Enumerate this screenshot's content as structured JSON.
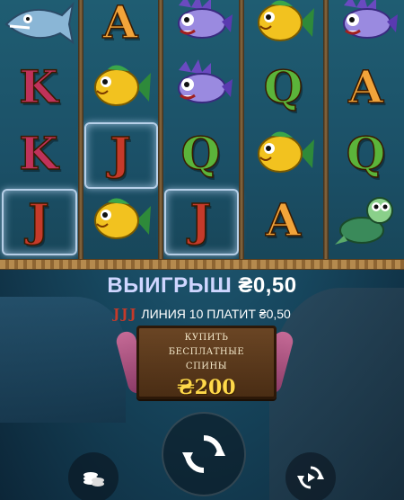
{
  "reels": {
    "rows": [
      [
        "shark",
        "A",
        "lionfish",
        "yellow-fish",
        "lionfish"
      ],
      [
        "K",
        "yellow-fish",
        "lionfish",
        "Q",
        "A"
      ],
      [
        "K",
        "J",
        "Q",
        "yellow-fish",
        "Q"
      ],
      [
        "J",
        "yellow-fish",
        "J",
        "A",
        "turtle"
      ]
    ],
    "highlighted_cells": [
      [
        2,
        1
      ],
      [
        3,
        0
      ],
      [
        3,
        2
      ]
    ]
  },
  "win": {
    "label": "ВЫИГРЫШ",
    "amount": "₴0,50"
  },
  "line_info": {
    "text": "ЛИНИЯ 10 ПЛАТИТ ₴0,50",
    "symbol_count": 3,
    "symbol": "J"
  },
  "buy_bonus": {
    "line1": "КУПИТЬ",
    "line2": "БЕСПЛАТНЫЕ",
    "line3": "СПИНЫ",
    "price": "₴200"
  },
  "controls": {
    "spin_icon": "refresh-arrows-icon",
    "coins_icon": "coins-stack-icon",
    "autoplay_icon": "autoplay-icon"
  },
  "colors": {
    "win_label": "#cfd6ff",
    "price": "#ffd94a",
    "frame_glow": "#d2e6ff"
  }
}
